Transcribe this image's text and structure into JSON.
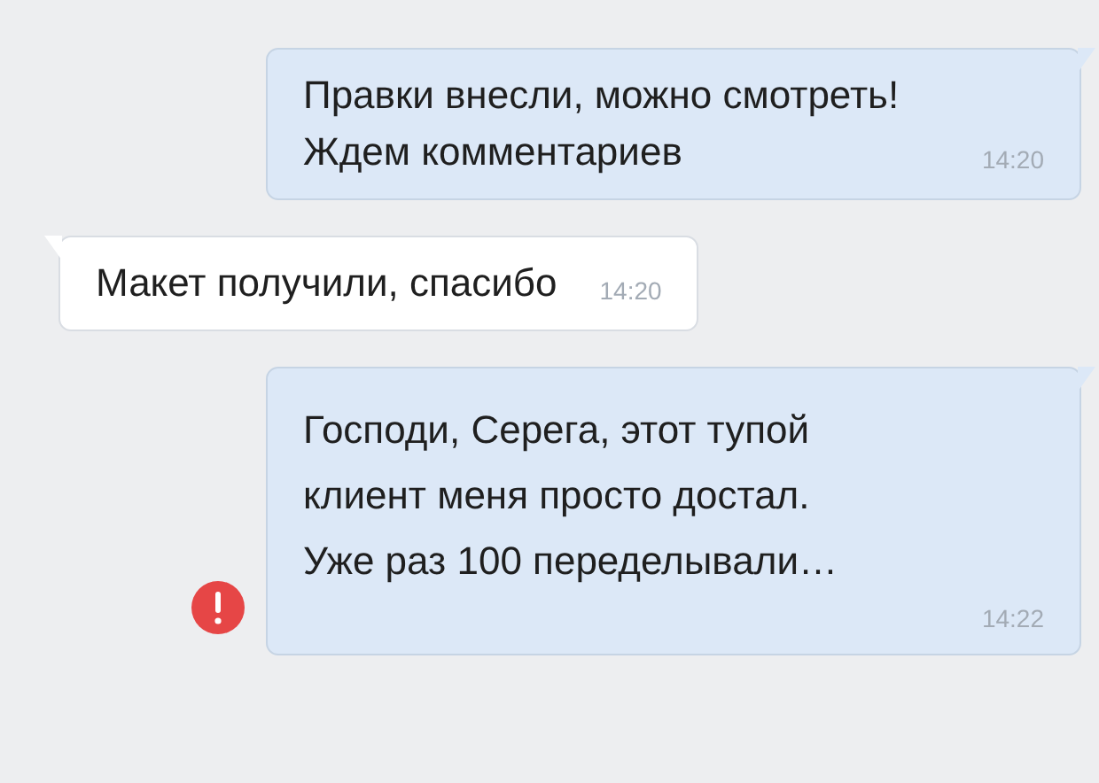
{
  "messages": [
    {
      "kind": "sent",
      "lines": [
        "Правки внесли, можно смотреть!",
        "Ждем комментариев"
      ],
      "time": "14:20"
    },
    {
      "kind": "received",
      "lines": [
        "Макет получили, спасибо"
      ],
      "time": "14:20"
    },
    {
      "kind": "undelivered",
      "lines": [
        "Господи, Серега, этот тупой",
        "клиент меня просто достал.",
        "Уже раз 100 переделывали…"
      ],
      "time": "14:22"
    }
  ]
}
